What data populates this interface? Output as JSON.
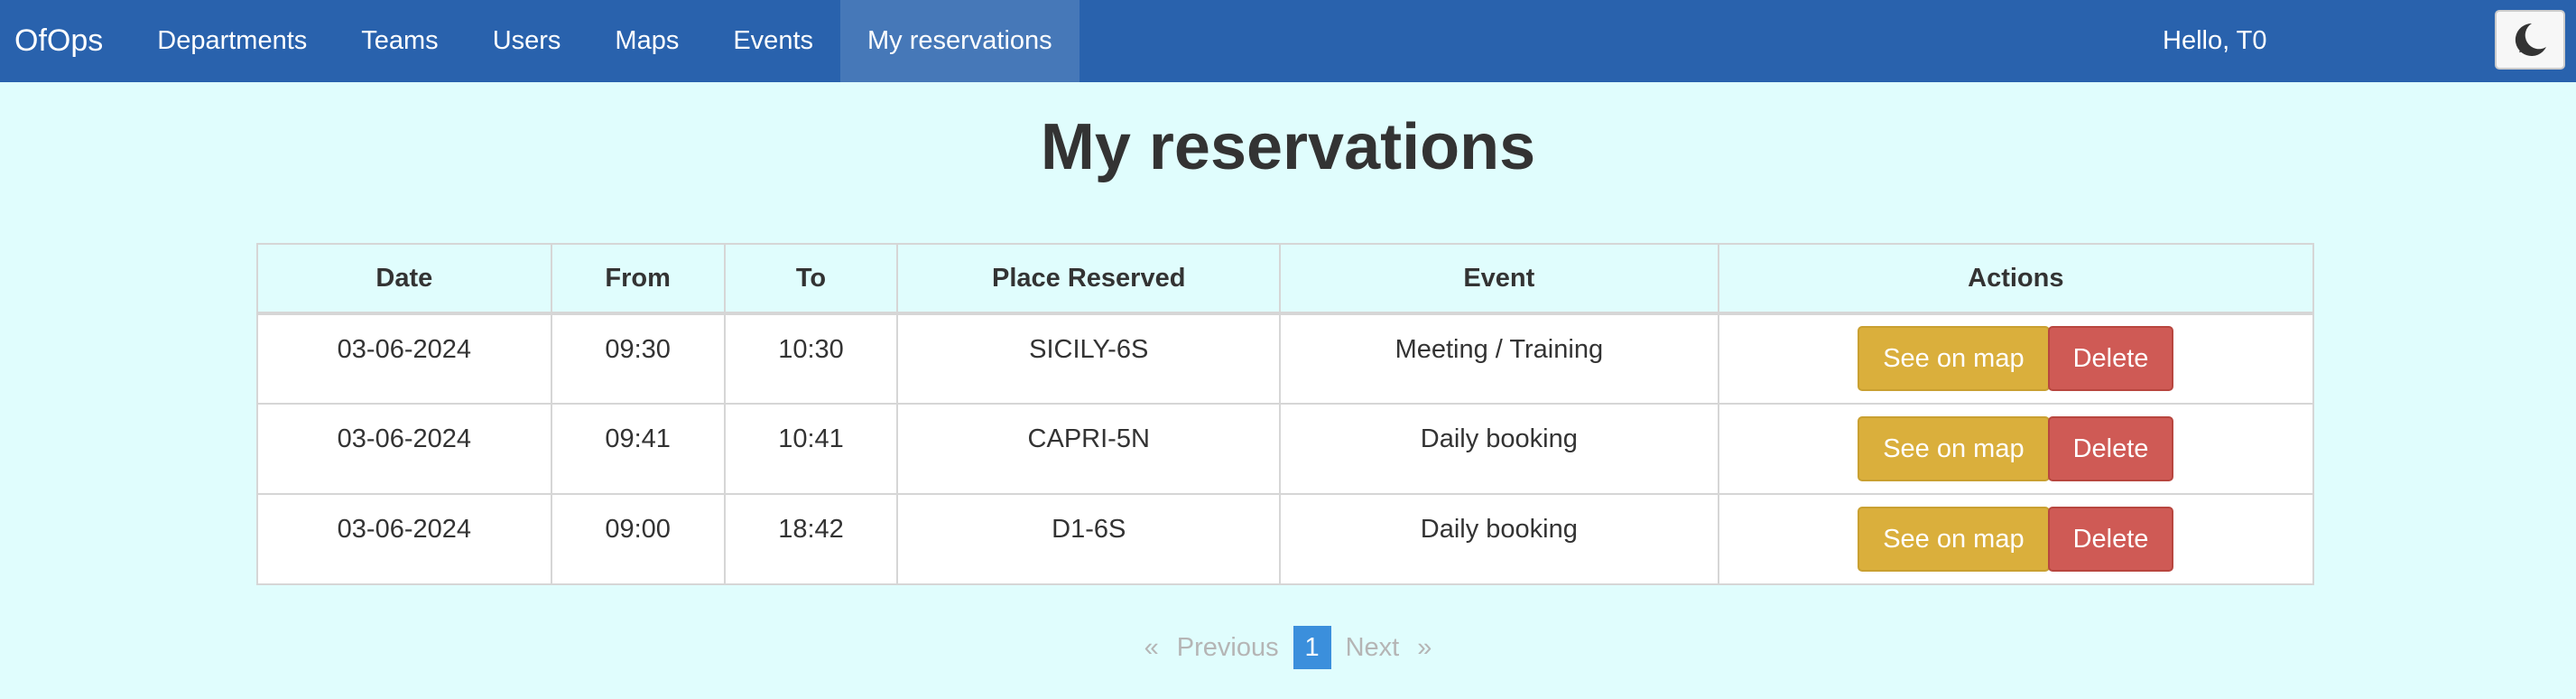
{
  "navbar": {
    "brand": "OfOps",
    "items": [
      {
        "label": "Departments"
      },
      {
        "label": "Teams"
      },
      {
        "label": "Users"
      },
      {
        "label": "Maps"
      },
      {
        "label": "Events"
      },
      {
        "label": "My reservations",
        "active": true
      }
    ],
    "greeting": "Hello, T0",
    "theme_icon": "moon-icon"
  },
  "page": {
    "title": "My reservations"
  },
  "table": {
    "headers": [
      "Date",
      "From",
      "To",
      "Place Reserved",
      "Event",
      "Actions"
    ],
    "rows": [
      {
        "date": "03-06-2024",
        "from": "09:30",
        "to": "10:30",
        "place": "SICILY-6S",
        "event": "Meeting / Training"
      },
      {
        "date": "03-06-2024",
        "from": "09:41",
        "to": "10:41",
        "place": "CAPRI-5N",
        "event": "Daily booking"
      },
      {
        "date": "03-06-2024",
        "from": "09:00",
        "to": "18:42",
        "place": "D1-6S",
        "event": "Daily booking"
      }
    ],
    "actions": {
      "map_label": "See on map",
      "delete_label": "Delete"
    }
  },
  "pagination": {
    "prev_arrow": "«",
    "prev_label": "Previous",
    "current_page": "1",
    "next_label": "Next",
    "next_arrow": "»"
  },
  "colors": {
    "navbar": "#2962ad",
    "background": "#e0fdfd",
    "see_on_map": "#daaf3c",
    "delete": "#cf5a55",
    "page_active": "#3b8fdc"
  }
}
